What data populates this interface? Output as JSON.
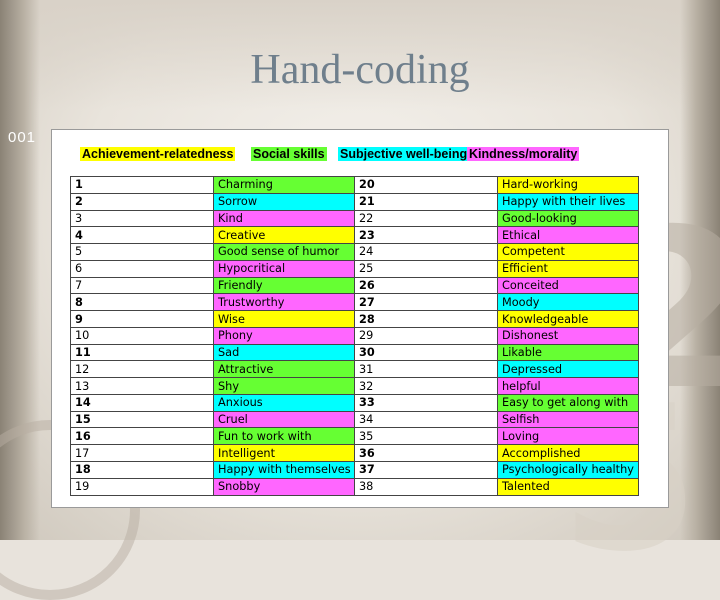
{
  "slide": {
    "title": "Hand-coding",
    "number": "001"
  },
  "legend": {
    "yellow": "Achievement-relatedness",
    "green": "Social skills",
    "cyan": "Subjective well-being",
    "magenta": "Kindness/morality"
  },
  "colors": {
    "yellow": "#ffff00",
    "green": "#66ff33",
    "cyan": "#00ffff",
    "magenta": "#ff66ff"
  },
  "table": {
    "rows": [
      {
        "n1": "1",
        "w1": "Charming",
        "c1": "green",
        "n2": "20",
        "w2": "Hard-working",
        "c2": "yellow"
      },
      {
        "n1": "2",
        "w1": "Sorrow",
        "c1": "cyan",
        "n2": "21",
        "w2": "Happy with their lives",
        "c2": "cyan"
      },
      {
        "n1": "3",
        "w1": "Kind",
        "c1": "magenta",
        "n2": "22",
        "w2": "Good-looking",
        "c2": "green"
      },
      {
        "n1": "4",
        "w1": "Creative",
        "c1": "yellow",
        "n2": "23",
        "w2": "Ethical",
        "c2": "magenta"
      },
      {
        "n1": "5",
        "w1": "Good sense of humor",
        "c1": "green",
        "n2": "24",
        "w2": "Competent",
        "c2": "yellow"
      },
      {
        "n1": "6",
        "w1": "Hypocritical",
        "c1": "magenta",
        "n2": "25",
        "w2": "Efficient",
        "c2": "yellow"
      },
      {
        "n1": "7",
        "w1": "Friendly",
        "c1": "green",
        "n2": "26",
        "w2": "Conceited",
        "c2": "magenta"
      },
      {
        "n1": "8",
        "w1": "Trustworthy",
        "c1": "magenta",
        "n2": "27",
        "w2": "Moody",
        "c2": "cyan"
      },
      {
        "n1": "9",
        "w1": "Wise",
        "c1": "yellow",
        "n2": "28",
        "w2": "Knowledgeable",
        "c2": "yellow"
      },
      {
        "n1": "10",
        "w1": "Phony",
        "c1": "magenta",
        "n2": "29",
        "w2": "Dishonest",
        "c2": "magenta"
      },
      {
        "n1": "11",
        "w1": "Sad",
        "c1": "cyan",
        "n2": "30",
        "w2": "Likable",
        "c2": "green"
      },
      {
        "n1": "12",
        "w1": "Attractive",
        "c1": "green",
        "n2": "31",
        "w2": "Depressed",
        "c2": "cyan"
      },
      {
        "n1": "13",
        "w1": "Shy",
        "c1": "green",
        "n2": "32",
        "w2": "helpful",
        "c2": "magenta"
      },
      {
        "n1": "14",
        "w1": "Anxious",
        "c1": "cyan",
        "n2": "33",
        "w2": "Easy to get along with",
        "c2": "green"
      },
      {
        "n1": "15",
        "w1": "Cruel",
        "c1": "magenta",
        "n2": "34",
        "w2": "Selfish",
        "c2": "magenta"
      },
      {
        "n1": "16",
        "w1": "Fun to work with",
        "c1": "green",
        "n2": "35",
        "w2": "Loving",
        "c2": "magenta"
      },
      {
        "n1": "17",
        "w1": "Intelligent",
        "c1": "yellow",
        "n2": "36",
        "w2": "Accomplished",
        "c2": "yellow"
      },
      {
        "n1": "18",
        "w1": "Happy with themselves",
        "c1": "cyan",
        "n2": "37",
        "w2": "Psychologically healthy",
        "c2": "cyan"
      },
      {
        "n1": "19",
        "w1": "Snobby",
        "c1": "magenta",
        "n2": "38",
        "w2": "Talented",
        "c2": "yellow"
      }
    ]
  }
}
